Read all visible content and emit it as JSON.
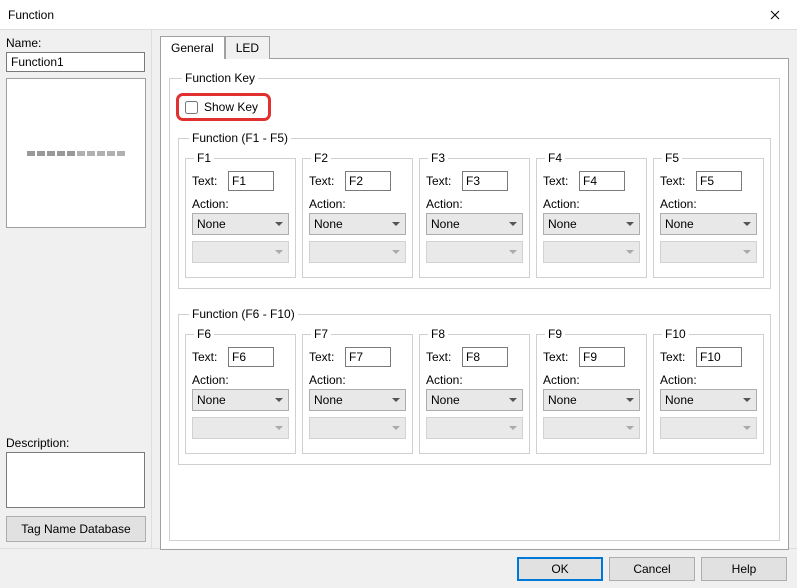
{
  "window": {
    "title": "Function"
  },
  "left": {
    "name_label": "Name:",
    "name_value": "Function1",
    "description_label": "Description:",
    "description_value": "",
    "tag_button": "Tag Name Database"
  },
  "tabs": {
    "general": "General",
    "led": "LED"
  },
  "fk": {
    "group_title": "Function Key",
    "show_key_label": "Show Key",
    "group1_title": "Function (F1 - F5)",
    "group2_title": "Function (F6 - F10)",
    "text_label": "Text:",
    "action_label": "Action:",
    "none": "None",
    "keys1": [
      {
        "legend": "F1",
        "text": "F1"
      },
      {
        "legend": "F2",
        "text": "F2"
      },
      {
        "legend": "F3",
        "text": "F3"
      },
      {
        "legend": "F4",
        "text": "F4"
      },
      {
        "legend": "F5",
        "text": "F5"
      }
    ],
    "keys2": [
      {
        "legend": "F6",
        "text": "F6"
      },
      {
        "legend": "F7",
        "text": "F7"
      },
      {
        "legend": "F8",
        "text": "F8"
      },
      {
        "legend": "F9",
        "text": "F9"
      },
      {
        "legend": "F10",
        "text": "F10"
      }
    ]
  },
  "buttons": {
    "ok": "OK",
    "cancel": "Cancel",
    "help": "Help"
  }
}
